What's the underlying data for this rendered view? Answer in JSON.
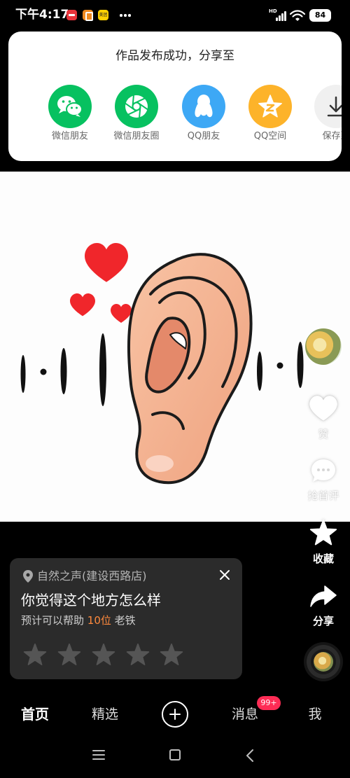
{
  "status_bar": {
    "time": "下午4:17",
    "notification_icons": [
      "red-app-icon",
      "orange-app-icon",
      "meituan-icon"
    ],
    "meituan_label": "美团",
    "network_label": "HD",
    "battery": "84"
  },
  "share_panel": {
    "title": "作品发布成功，分享至",
    "targets": [
      {
        "label": "微信朋友",
        "icon": "wechat-icon",
        "color": "#07C160"
      },
      {
        "label": "微信朋友圈",
        "icon": "wechat-moments-icon",
        "color": "#07C160"
      },
      {
        "label": "QQ朋友",
        "icon": "qq-icon",
        "color": "#3DA8F5"
      },
      {
        "label": "QQ空间",
        "icon": "qzone-icon",
        "color": "#FDB32A"
      },
      {
        "label": "保存到",
        "icon": "download-icon",
        "color": "#F0F0F0"
      }
    ]
  },
  "side_actions": {
    "avatar_icon": "creator-avatar",
    "like": {
      "label": "赞",
      "icon": "heart-icon"
    },
    "comment": {
      "label": "抢首评",
      "icon": "comment-icon"
    },
    "favorite": {
      "label": "收藏",
      "icon": "star-icon"
    },
    "share": {
      "label": "分享",
      "icon": "share-arrow-icon"
    },
    "music_icon": "music-disc-icon"
  },
  "poi_card": {
    "location_icon": "location-pin-icon",
    "location": "自然之声(建设西路店)",
    "question": "你觉得这个地方怎么样",
    "help_prefix": "预计可以帮助",
    "help_count": "10位",
    "help_suffix": "老铁",
    "rating": {
      "value": 0,
      "max": 5
    },
    "close_icon": "close-icon",
    "accent_color": "#FF8A3D"
  },
  "bottom_nav": {
    "items": [
      {
        "label": "首页",
        "active": true
      },
      {
        "label": "精选",
        "active": false
      },
      {
        "label": "消息",
        "active": false,
        "badge": "99+"
      },
      {
        "label": "我",
        "active": false
      }
    ],
    "create_icon": "plus-icon",
    "badge_color": "#FE2C55"
  },
  "system_nav": {
    "icons": [
      "menu-icon",
      "home-icon",
      "back-icon"
    ]
  }
}
